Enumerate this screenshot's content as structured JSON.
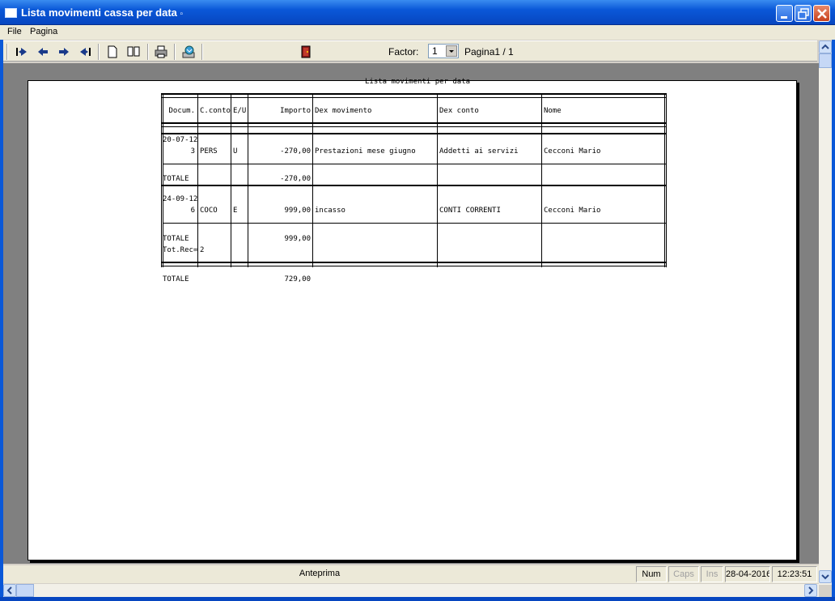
{
  "window": {
    "title": "Lista movimenti cassa per data",
    "title_suffix": "▫"
  },
  "menu": {
    "items": [
      "File",
      "Pagina"
    ]
  },
  "toolbar": {
    "factor_label": "Factor:",
    "factor_value": "1",
    "page_label": "Pagina1 / 1",
    "icons": [
      "first-page-icon",
      "prev-page-icon",
      "next-page-icon",
      "last-page-icon",
      "single-page-icon",
      "two-pages-icon",
      "print-icon",
      "export-icon",
      "exit-door-icon"
    ]
  },
  "report": {
    "title": "Lista movimenti per data",
    "headers": {
      "docum": "Docum.",
      "cconto": "C.conto",
      "eu": "E/U",
      "importo": "Importo",
      "dex_mov": "Dex movimento",
      "dex_conto": "Dex conto",
      "nome": "Nome"
    },
    "groups": [
      {
        "date": "20-07-12",
        "num": "3",
        "cconto": "PERS",
        "eu": "U",
        "importo": "-270,00",
        "dex_mov": "Prestazioni mese giugno",
        "dex_conto": "Addetti ai servizi",
        "nome": "Cecconi Mario",
        "total_label": "TOTALE",
        "total": "-270,00"
      },
      {
        "date": "24-09-12",
        "num": "6",
        "cconto": "COCO",
        "eu": "E",
        "importo": "999,00",
        "dex_mov": "incasso",
        "dex_conto": "CONTI CORRENTI",
        "nome": "Cecconi Mario",
        "total_label": "TOTALE",
        "total": "999,00",
        "rec_label": "Tot.Rec=",
        "rec_value": "2"
      }
    ],
    "grand_total_label": "TOTALE",
    "grand_total": "729,00"
  },
  "status": {
    "main": "Anteprima",
    "num": "Num",
    "caps": "Caps",
    "ins": "Ins",
    "date": "28-04-2016",
    "time": "12:23:51"
  },
  "colors": {
    "titlebar": "#0a58d8",
    "workspace": "#808080",
    "paper": "#ffffff"
  }
}
